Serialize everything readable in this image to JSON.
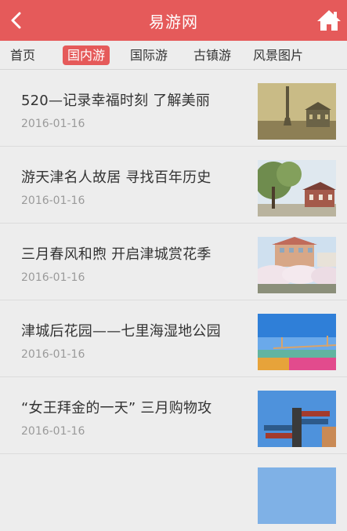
{
  "header": {
    "title": "易游网"
  },
  "tabs": [
    {
      "label": "首页",
      "active": false
    },
    {
      "label": "国内游",
      "active": true
    },
    {
      "label": "国际游",
      "active": false
    },
    {
      "label": "古镇游",
      "active": false
    },
    {
      "label": "风景图片",
      "active": false
    }
  ],
  "articles": [
    {
      "title": "520—记录幸福时刻 了解美丽",
      "date": "2016-01-16"
    },
    {
      "title": "游天津名人故居 寻找百年历史",
      "date": "2016-01-16"
    },
    {
      "title": "三月春风和煦 开启津城赏花季",
      "date": "2016-01-16"
    },
    {
      "title": "津城后花园——七里海湿地公园",
      "date": "2016-01-16"
    },
    {
      "title": "“女王拜金的一天” 三月购物攻",
      "date": "2016-01-16"
    }
  ],
  "colors": {
    "accent": "#e55a5a",
    "background": "#ededed"
  }
}
